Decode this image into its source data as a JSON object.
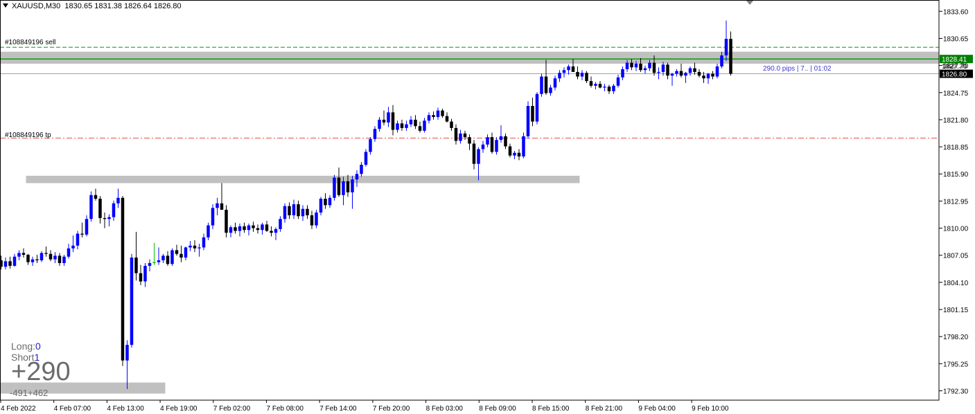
{
  "header": {
    "symbol": "XAUUSD,M30",
    "ohlc": "1830.65 1831.38 1826.64 1826.80"
  },
  "orders": {
    "sell_label": "#108849196 sell",
    "tp_label": "#108849196 tp",
    "sell_price_tag": "1828.41",
    "bid_tag_partial": "1827.70",
    "bid_price_tag": "1826.80"
  },
  "panel": {
    "long_label": "Long:",
    "long_value": "0",
    "short_label": "Short",
    "short_value": "1",
    "profit_big": "+290",
    "profit_small": "-491+462",
    "pips_text": "290.0 pips | 7.. | 01:02"
  },
  "colors": {
    "bull": "#0000ff",
    "bear": "#000000",
    "doji": "#00c000",
    "zone": "#c0c0c0",
    "sell_line": "#00a000",
    "tp_line": "#e05050",
    "price_tag_bg": "#000000",
    "sell_tag_bg": "#008000"
  },
  "chart_data": {
    "type": "candlestick",
    "symbol": "XAUUSD",
    "timeframe": "M30",
    "y_ticks": [
      "1833.60",
      "1830.65",
      "1827.70",
      "1824.75",
      "1821.80",
      "1818.85",
      "1815.90",
      "1812.95",
      "1810.00",
      "1807.05",
      "1804.10",
      "1801.15",
      "1798.20",
      "1795.25",
      "1792.30"
    ],
    "ylim": [
      1791.5,
      1834.7
    ],
    "x_ticks": [
      "4 Feb 2022",
      "4 Feb 07:00",
      "4 Feb 13:00",
      "4 Feb 19:00",
      "7 Feb 02:00",
      "7 Feb 08:00",
      "7 Feb 14:00",
      "7 Feb 20:00",
      "8 Feb 03:00",
      "8 Feb 09:00",
      "8 Feb 15:00",
      "8 Feb 21:00",
      "9 Feb 04:00",
      "9 Feb 10:00"
    ],
    "sell_price": 1828.41,
    "current_price": 1826.8,
    "take_profit": 1819.8,
    "zones": [
      {
        "start_index": 0,
        "end_index": 166,
        "low": 1827.9,
        "high": 1829.2
      },
      {
        "start_index": 6,
        "end_index": 128,
        "low": 1814.9,
        "high": 1815.7
      },
      {
        "start_index": 0,
        "end_index": 36,
        "low": 1792.0,
        "high": 1793.2
      }
    ],
    "candles": [
      [
        1806.5,
        1807.0,
        1805.5,
        1805.8
      ],
      [
        1805.8,
        1806.8,
        1805.5,
        1806.4
      ],
      [
        1806.4,
        1806.9,
        1805.6,
        1805.9
      ],
      [
        1805.9,
        1807.2,
        1805.8,
        1806.9
      ],
      [
        1806.9,
        1807.6,
        1806.5,
        1807.3
      ],
      [
        1807.3,
        1807.8,
        1806.8,
        1807.1
      ],
      [
        1807.1,
        1807.2,
        1806.0,
        1806.3
      ],
      [
        1806.3,
        1806.9,
        1805.9,
        1806.6
      ],
      [
        1806.6,
        1807.1,
        1806.2,
        1806.5
      ],
      [
        1806.5,
        1807.5,
        1806.3,
        1807.3
      ],
      [
        1807.3,
        1808.0,
        1806.9,
        1807.2
      ],
      [
        1807.2,
        1807.6,
        1806.4,
        1806.6
      ],
      [
        1806.6,
        1807.4,
        1806.2,
        1807.0
      ],
      [
        1807.0,
        1807.3,
        1805.9,
        1806.2
      ],
      [
        1806.2,
        1807.1,
        1805.9,
        1806.9
      ],
      [
        1806.9,
        1808.3,
        1806.7,
        1807.8
      ],
      [
        1807.8,
        1809.2,
        1807.4,
        1808.1
      ],
      [
        1808.1,
        1809.7,
        1807.7,
        1809.4
      ],
      [
        1809.4,
        1810.6,
        1809.0,
        1809.3
      ],
      [
        1809.3,
        1811.4,
        1809.1,
        1811.0
      ],
      [
        1811.0,
        1814.0,
        1810.7,
        1813.6
      ],
      [
        1813.6,
        1814.3,
        1813.0,
        1813.2
      ],
      [
        1813.2,
        1813.5,
        1810.5,
        1811.1
      ],
      [
        1811.1,
        1811.7,
        1810.0,
        1811.0
      ],
      [
        1811.0,
        1811.5,
        1810.2,
        1811.2
      ],
      [
        1811.2,
        1813.0,
        1810.8,
        1812.7
      ],
      [
        1812.7,
        1814.3,
        1812.2,
        1813.3
      ],
      [
        1813.3,
        1813.5,
        1795.0,
        1795.6
      ],
      [
        1795.6,
        1797.8,
        1792.5,
        1797.3
      ],
      [
        1797.3,
        1807.2,
        1797.0,
        1806.8
      ],
      [
        1806.8,
        1809.6,
        1804.3,
        1805.1
      ],
      [
        1805.1,
        1806.0,
        1803.8,
        1804.2
      ],
      [
        1804.2,
        1806.2,
        1803.6,
        1805.9
      ],
      [
        1805.9,
        1806.6,
        1805.3,
        1806.2
      ],
      [
        1806.2,
        1808.4,
        1806.0,
        1806.3
      ],
      [
        1806.3,
        1807.9,
        1806.0,
        1806.5
      ],
      [
        1806.5,
        1807.2,
        1806.2,
        1807.0
      ],
      [
        1807.0,
        1807.5,
        1805.9,
        1806.1
      ],
      [
        1806.1,
        1807.8,
        1805.9,
        1807.6
      ],
      [
        1807.6,
        1808.2,
        1807.0,
        1807.2
      ],
      [
        1807.2,
        1808.1,
        1806.3,
        1806.8
      ],
      [
        1806.8,
        1808.0,
        1806.5,
        1807.9
      ],
      [
        1807.9,
        1808.6,
        1807.5,
        1808.1
      ],
      [
        1808.1,
        1808.7,
        1807.4,
        1807.8
      ],
      [
        1807.8,
        1808.3,
        1806.9,
        1807.9
      ],
      [
        1807.9,
        1809.4,
        1807.6,
        1809.0
      ],
      [
        1809.0,
        1810.6,
        1808.7,
        1810.3
      ],
      [
        1810.3,
        1812.6,
        1809.9,
        1812.2
      ],
      [
        1812.2,
        1813.3,
        1811.4,
        1812.7
      ],
      [
        1812.7,
        1814.9,
        1812.0,
        1812.0
      ],
      [
        1812.0,
        1812.5,
        1809.0,
        1809.5
      ],
      [
        1809.5,
        1810.3,
        1809.0,
        1810.1
      ],
      [
        1810.1,
        1810.6,
        1809.4,
        1809.7
      ],
      [
        1809.7,
        1810.5,
        1809.1,
        1810.2
      ],
      [
        1810.2,
        1810.6,
        1809.5,
        1809.8
      ],
      [
        1809.8,
        1810.5,
        1809.2,
        1810.3
      ],
      [
        1810.3,
        1810.7,
        1809.6,
        1810.0
      ],
      [
        1810.0,
        1810.4,
        1809.4,
        1809.8
      ],
      [
        1809.8,
        1810.6,
        1809.3,
        1810.4
      ],
      [
        1810.4,
        1810.8,
        1809.6,
        1809.7
      ],
      [
        1809.7,
        1810.2,
        1809.1,
        1809.5
      ],
      [
        1809.5,
        1810.1,
        1808.7,
        1809.9
      ],
      [
        1809.9,
        1811.3,
        1809.6,
        1811.0
      ],
      [
        1811.0,
        1812.7,
        1810.6,
        1812.4
      ],
      [
        1812.4,
        1812.8,
        1811.0,
        1811.4
      ],
      [
        1811.4,
        1813.1,
        1811.0,
        1812.6
      ],
      [
        1812.6,
        1813.0,
        1811.0,
        1811.3
      ],
      [
        1811.3,
        1812.5,
        1810.8,
        1812.1
      ],
      [
        1812.1,
        1812.5,
        1811.0,
        1811.4
      ],
      [
        1811.4,
        1811.9,
        1809.9,
        1810.3
      ],
      [
        1810.3,
        1812.0,
        1810.0,
        1811.7
      ],
      [
        1811.7,
        1813.4,
        1811.4,
        1813.2
      ],
      [
        1813.2,
        1813.8,
        1812.1,
        1812.5
      ],
      [
        1812.5,
        1813.6,
        1812.2,
        1813.3
      ],
      [
        1813.3,
        1815.8,
        1813.0,
        1815.5
      ],
      [
        1815.5,
        1816.6,
        1813.4,
        1813.6
      ],
      [
        1813.6,
        1815.6,
        1812.5,
        1815.1
      ],
      [
        1815.1,
        1815.8,
        1813.4,
        1813.9
      ],
      [
        1813.9,
        1815.7,
        1812.1,
        1815.3
      ],
      [
        1815.3,
        1816.3,
        1814.5,
        1815.9
      ],
      [
        1815.9,
        1817.2,
        1815.6,
        1816.9
      ],
      [
        1816.9,
        1818.6,
        1816.7,
        1818.3
      ],
      [
        1818.3,
        1819.9,
        1818.0,
        1819.7
      ],
      [
        1819.7,
        1821.1,
        1819.4,
        1820.8
      ],
      [
        1820.8,
        1822.1,
        1820.5,
        1821.8
      ],
      [
        1821.8,
        1822.8,
        1821.2,
        1821.5
      ],
      [
        1821.5,
        1823.2,
        1821.0,
        1822.6
      ],
      [
        1822.6,
        1823.4,
        1820.1,
        1820.7
      ],
      [
        1820.7,
        1821.7,
        1820.4,
        1821.4
      ],
      [
        1821.4,
        1821.8,
        1820.6,
        1820.9
      ],
      [
        1820.9,
        1821.7,
        1820.6,
        1821.3
      ],
      [
        1821.3,
        1822.2,
        1821.0,
        1821.8
      ],
      [
        1821.8,
        1822.3,
        1820.8,
        1821.1
      ],
      [
        1821.1,
        1821.6,
        1820.4,
        1820.6
      ],
      [
        1820.6,
        1822.0,
        1820.4,
        1821.7
      ],
      [
        1821.7,
        1822.6,
        1821.4,
        1822.3
      ],
      [
        1822.3,
        1822.7,
        1821.8,
        1822.1
      ],
      [
        1822.1,
        1823.1,
        1821.8,
        1822.8
      ],
      [
        1822.8,
        1823.0,
        1822.0,
        1822.2
      ],
      [
        1822.2,
        1822.6,
        1821.5,
        1821.6
      ],
      [
        1821.6,
        1821.9,
        1820.6,
        1820.9
      ],
      [
        1820.9,
        1821.3,
        1819.1,
        1819.5
      ],
      [
        1819.5,
        1820.7,
        1819.2,
        1820.3
      ],
      [
        1820.3,
        1820.6,
        1819.6,
        1819.9
      ],
      [
        1819.9,
        1820.2,
        1818.5,
        1819.2
      ],
      [
        1819.2,
        1819.6,
        1816.4,
        1817.0
      ],
      [
        1817.0,
        1818.8,
        1815.2,
        1818.6
      ],
      [
        1818.6,
        1819.5,
        1818.2,
        1819.1
      ],
      [
        1819.1,
        1820.2,
        1818.8,
        1819.9
      ],
      [
        1819.9,
        1820.4,
        1818.1,
        1818.3
      ],
      [
        1818.3,
        1819.9,
        1818.0,
        1819.6
      ],
      [
        1819.6,
        1821.2,
        1819.3,
        1820.0
      ],
      [
        1820.0,
        1820.3,
        1818.6,
        1818.9
      ],
      [
        1818.9,
        1819.2,
        1817.7,
        1817.9
      ],
      [
        1817.9,
        1818.4,
        1817.5,
        1818.2
      ],
      [
        1818.2,
        1818.6,
        1817.4,
        1817.8
      ],
      [
        1817.8,
        1820.4,
        1817.6,
        1820.0
      ],
      [
        1820.0,
        1823.8,
        1819.7,
        1823.3
      ],
      [
        1823.3,
        1824.2,
        1821.1,
        1821.6
      ],
      [
        1821.6,
        1824.8,
        1821.3,
        1824.6
      ],
      [
        1824.6,
        1826.8,
        1824.3,
        1826.5
      ],
      [
        1826.5,
        1828.3,
        1824.5,
        1824.7
      ],
      [
        1824.7,
        1825.6,
        1824.4,
        1825.3
      ],
      [
        1825.3,
        1826.6,
        1825.0,
        1826.3
      ],
      [
        1826.3,
        1827.2,
        1825.9,
        1826.9
      ],
      [
        1826.9,
        1827.5,
        1826.4,
        1827.2
      ],
      [
        1827.2,
        1827.8,
        1826.7,
        1827.6
      ],
      [
        1827.6,
        1828.4,
        1827.2,
        1827.0
      ],
      [
        1827.0,
        1827.6,
        1826.2,
        1826.5
      ],
      [
        1826.5,
        1827.2,
        1826.1,
        1826.9
      ],
      [
        1826.9,
        1827.1,
        1825.8,
        1826.0
      ],
      [
        1826.0,
        1826.5,
        1825.3,
        1825.5
      ],
      [
        1825.5,
        1825.9,
        1825.1,
        1825.7
      ],
      [
        1825.7,
        1826.0,
        1825.2,
        1825.3
      ],
      [
        1825.3,
        1825.7,
        1824.9,
        1825.4
      ],
      [
        1825.4,
        1825.6,
        1824.6,
        1824.9
      ],
      [
        1824.9,
        1825.7,
        1824.6,
        1825.5
      ],
      [
        1825.5,
        1826.7,
        1825.3,
        1826.4
      ],
      [
        1826.4,
        1827.6,
        1826.1,
        1827.3
      ],
      [
        1827.3,
        1828.3,
        1827.0,
        1828.0
      ],
      [
        1828.0,
        1828.4,
        1827.2,
        1827.5
      ],
      [
        1827.5,
        1828.2,
        1827.1,
        1827.9
      ],
      [
        1827.9,
        1828.5,
        1827.0,
        1827.2
      ],
      [
        1827.2,
        1827.7,
        1826.8,
        1827.4
      ],
      [
        1827.4,
        1828.3,
        1827.1,
        1828.0
      ],
      [
        1828.0,
        1828.8,
        1826.6,
        1826.9
      ],
      [
        1826.9,
        1827.5,
        1826.2,
        1827.0
      ],
      [
        1827.0,
        1828.1,
        1826.6,
        1827.8
      ],
      [
        1827.8,
        1828.0,
        1826.2,
        1826.6
      ],
      [
        1826.6,
        1826.9,
        1825.5,
        1826.8
      ],
      [
        1826.8,
        1827.3,
        1826.5,
        1827.1
      ],
      [
        1827.1,
        1827.9,
        1826.4,
        1826.6
      ],
      [
        1826.6,
        1827.0,
        1825.8,
        1826.9
      ],
      [
        1826.9,
        1827.6,
        1826.6,
        1827.4
      ],
      [
        1827.4,
        1828.0,
        1826.7,
        1827.0
      ],
      [
        1827.0,
        1827.3,
        1826.4,
        1826.6
      ],
      [
        1826.6,
        1827.0,
        1825.8,
        1826.3
      ],
      [
        1826.3,
        1826.9,
        1825.7,
        1826.8
      ],
      [
        1826.8,
        1827.1,
        1826.2,
        1826.5
      ],
      [
        1826.5,
        1827.9,
        1826.3,
        1827.6
      ],
      [
        1827.6,
        1829.2,
        1827.4,
        1828.8
      ],
      [
        1828.8,
        1832.6,
        1828.2,
        1830.6
      ],
      [
        1830.6,
        1831.4,
        1826.6,
        1826.8
      ]
    ],
    "doji_indices": [
      34
    ]
  }
}
